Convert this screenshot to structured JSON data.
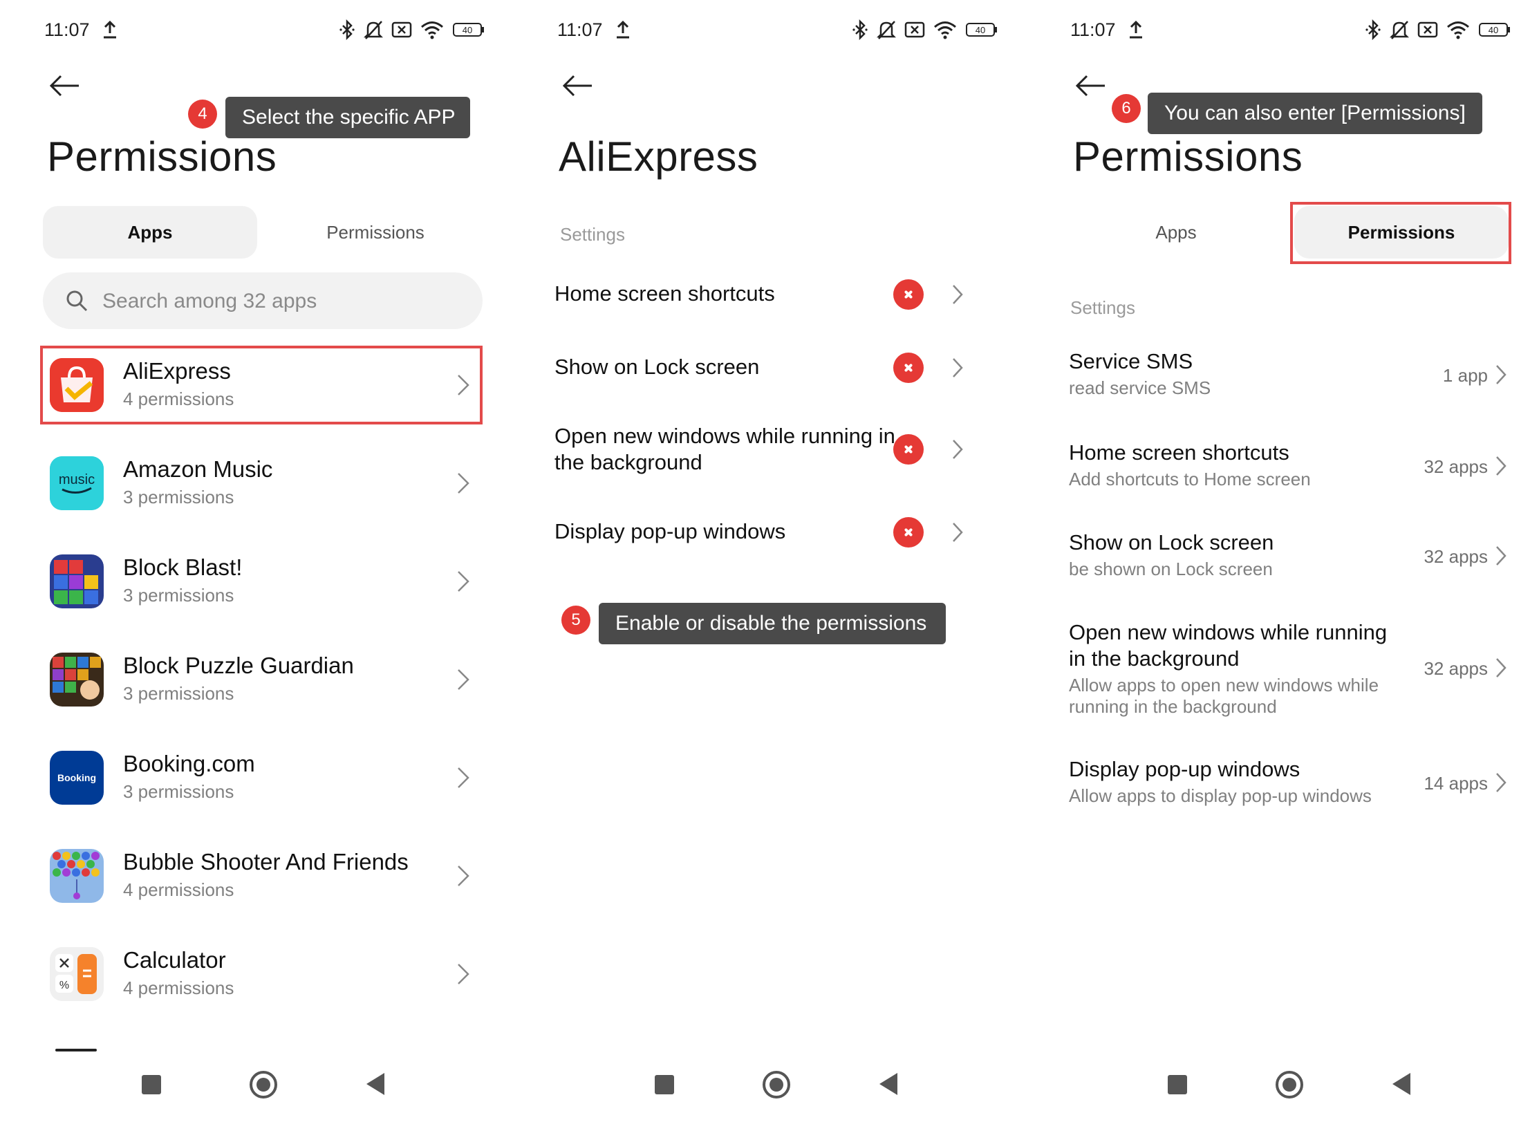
{
  "status": {
    "time": "11:07",
    "battery": "40"
  },
  "panel1": {
    "title": "Permissions",
    "tabs": [
      {
        "label": "Apps",
        "active": true
      },
      {
        "label": "Permissions",
        "active": false
      }
    ],
    "search_placeholder": "Search among 32 apps",
    "apps": [
      {
        "name": "AliExpress",
        "sub": "4 permissions",
        "icon": "aliexpress-icon"
      },
      {
        "name": "Amazon Music",
        "sub": "3 permissions",
        "icon": "amazon-music-icon"
      },
      {
        "name": "Block Blast!",
        "sub": "3 permissions",
        "icon": "block-blast-icon"
      },
      {
        "name": "Block Puzzle Guardian",
        "sub": "3 permissions",
        "icon": "block-puzzle-guardian-icon"
      },
      {
        "name": "Booking.com",
        "sub": "3 permissions",
        "icon": "booking-icon"
      },
      {
        "name": "Bubble Shooter And Friends",
        "sub": "4 permissions",
        "icon": "bubble-shooter-icon"
      },
      {
        "name": "Calculator",
        "sub": "4 permissions",
        "icon": "calculator-icon"
      }
    ],
    "step": {
      "number": "4",
      "text": "Select the specific APP"
    }
  },
  "panel2": {
    "title": "AliExpress",
    "section": "Settings",
    "settings": [
      {
        "title": "Home screen shortcuts",
        "enabled": false
      },
      {
        "title": "Show on Lock screen",
        "enabled": false
      },
      {
        "title": "Open new windows while running in the background",
        "enabled": false
      },
      {
        "title": "Display pop-up windows",
        "enabled": false
      }
    ],
    "step": {
      "number": "5",
      "text": "Enable or disable the permissions"
    }
  },
  "panel3": {
    "title": "Permissions",
    "tabs": [
      {
        "label": "Apps",
        "active": false
      },
      {
        "label": "Permissions",
        "active": true
      }
    ],
    "section": "Settings",
    "permissions": [
      {
        "title": "Service SMS",
        "sub": "read service SMS",
        "count": "1 app"
      },
      {
        "title": "Home screen shortcuts",
        "sub": "Add shortcuts to Home screen",
        "count": "32 apps"
      },
      {
        "title": "Show on Lock screen",
        "sub": "be shown on Lock screen",
        "count": "32 apps"
      },
      {
        "title": "Open new windows while running in the background",
        "sub": "Allow apps to open new windows while running in the background",
        "count": "32 apps"
      },
      {
        "title": "Display pop-up windows",
        "sub": "Allow apps to display pop-up windows",
        "count": "14 apps"
      }
    ],
    "step": {
      "number": "6",
      "text": "You can also enter [Permissions]"
    }
  },
  "colors": {
    "highlight": "#e34b4b",
    "badge": "#e53935",
    "tooltip": "#4a4a4a",
    "toggle_off": "#e53935"
  }
}
